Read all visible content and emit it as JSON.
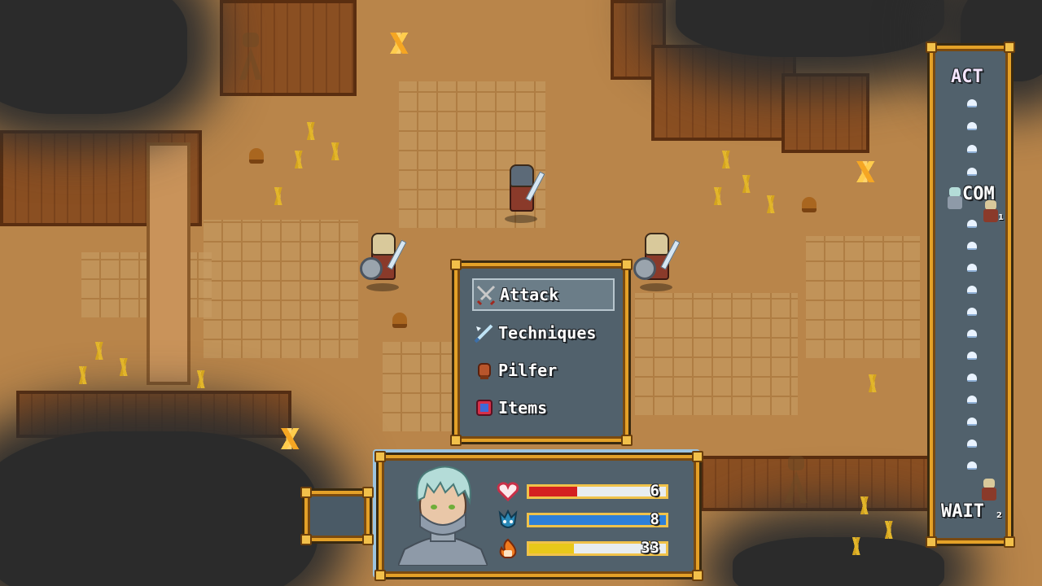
{
  "command_menu": {
    "items": [
      {
        "label": "Attack",
        "icon": "crossed-swords-icon",
        "selected": true
      },
      {
        "label": "Techniques",
        "icon": "sparkle-sword-icon",
        "selected": false
      },
      {
        "label": "Pilfer",
        "icon": "glove-icon",
        "selected": false
      },
      {
        "label": "Items",
        "icon": "potion-icon",
        "selected": false
      }
    ]
  },
  "status": {
    "hp": {
      "icon": "heart-icon",
      "value": "6",
      "fill": 0.35,
      "color": "#d42020"
    },
    "mp": {
      "icon": "mana-icon",
      "value": "8",
      "fill": 1.0,
      "color": "#2e7fd8"
    },
    "tp": {
      "icon": "flame-icon",
      "value": "33",
      "fill": 0.33,
      "color": "#e8c81a"
    }
  },
  "turn_order": {
    "act_label": "ACT",
    "com_label": "COM",
    "wait_label": "WAIT",
    "unit_markers": [
      "1",
      "2"
    ]
  },
  "colors": {
    "frame_gold": "#e4a128",
    "panel_slate": "#51616c",
    "ground": "#b9854a"
  }
}
